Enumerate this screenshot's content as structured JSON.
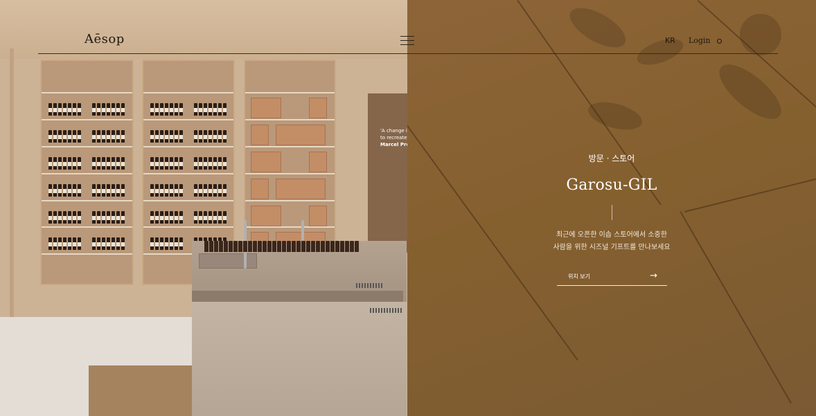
{
  "header": {
    "logo": "Aēsop",
    "lang": "KR",
    "login": "Login"
  },
  "hero": {
    "eyebrow": "방문 · 스토어",
    "store_name": "Garosu-GIL",
    "description_line1": "최근에 오픈한 이솝 스토어에서 소중한",
    "description_line2": "사람을 위한 시즈널 기프트를 만나보세요",
    "cta_label": "위치 보기",
    "cta_arrow": "→"
  },
  "photo": {
    "poster_line1": "'A change in",
    "poster_line2": "to recreate t",
    "poster_line3": "Marcel Prou"
  },
  "colors": {
    "panel_brown": "#8a6136",
    "text_dark": "#1f1a15",
    "hero_text": "#ffffff"
  },
  "icons": [
    "menu-icon",
    "search-icon",
    "arrow-right-icon"
  ]
}
